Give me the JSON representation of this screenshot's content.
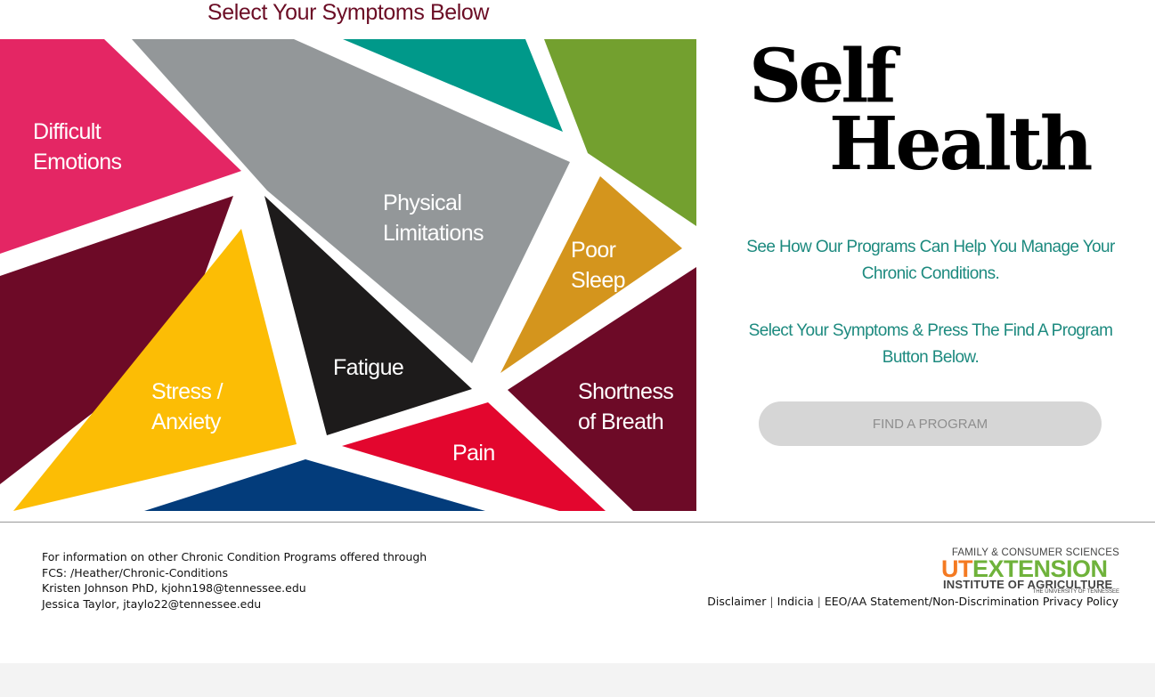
{
  "heading": "Select Your Symptoms Below",
  "symptoms": [
    {
      "id": "difficult-emotions",
      "lines": [
        "Difficult",
        "Emotions"
      ],
      "color": "#e42664"
    },
    {
      "id": "physical-limitations",
      "lines": [
        "Physical",
        "Limitations"
      ],
      "color": "#939799"
    },
    {
      "id": "poor-sleep",
      "lines": [
        "Poor",
        "Sleep"
      ],
      "color": "#d4951d"
    },
    {
      "id": "fatigue",
      "lines": [
        "Fatigue"
      ],
      "color": "#1d1b1b"
    },
    {
      "id": "stress-anxiety",
      "lines": [
        "Stress /",
        "Anxiety"
      ],
      "color": "#fcbd05"
    },
    {
      "id": "shortness-of-breath",
      "lines": [
        "Shortness",
        "of Breath"
      ],
      "color": "#6d0a27"
    },
    {
      "id": "pain",
      "lines": [
        "Pain"
      ],
      "color": "#e3062e"
    }
  ],
  "decorative_colors": {
    "teal": "#00998a",
    "green": "#73a02f",
    "maroon": "#6d0a27",
    "navy": "#033c7b"
  },
  "logo": {
    "line1": "Self",
    "line2": "Health"
  },
  "description": "See How Our Programs Can Help You Manage Your Chronic Conditions.",
  "instruction": "Select Your Symptoms & Press The Find A Program Button Below.",
  "find_button": "FIND A PROGRAM",
  "footer": {
    "lines": [
      "For information on other Chronic Condition Programs offered through",
      "FCS: /Heather/Chronic-Conditions",
      "Kristen Johnson PhD, kjohn198@tennessee.edu",
      "Jessica Taylor, jtaylo22@tennessee.edu"
    ],
    "ut_logo": {
      "top": "FAMILY & CONSUMER SCIENCES",
      "ut": "UT",
      "extension": "EXTENSION",
      "institute": "INSTITUTE OF AGRICULTURE",
      "university": "THE UNIVERSITY OF TENNESSEE"
    },
    "links": [
      "Disclaimer",
      "Indicia",
      "EEO/AA Statement/Non-Discrimination",
      "Privacy Policy"
    ]
  }
}
